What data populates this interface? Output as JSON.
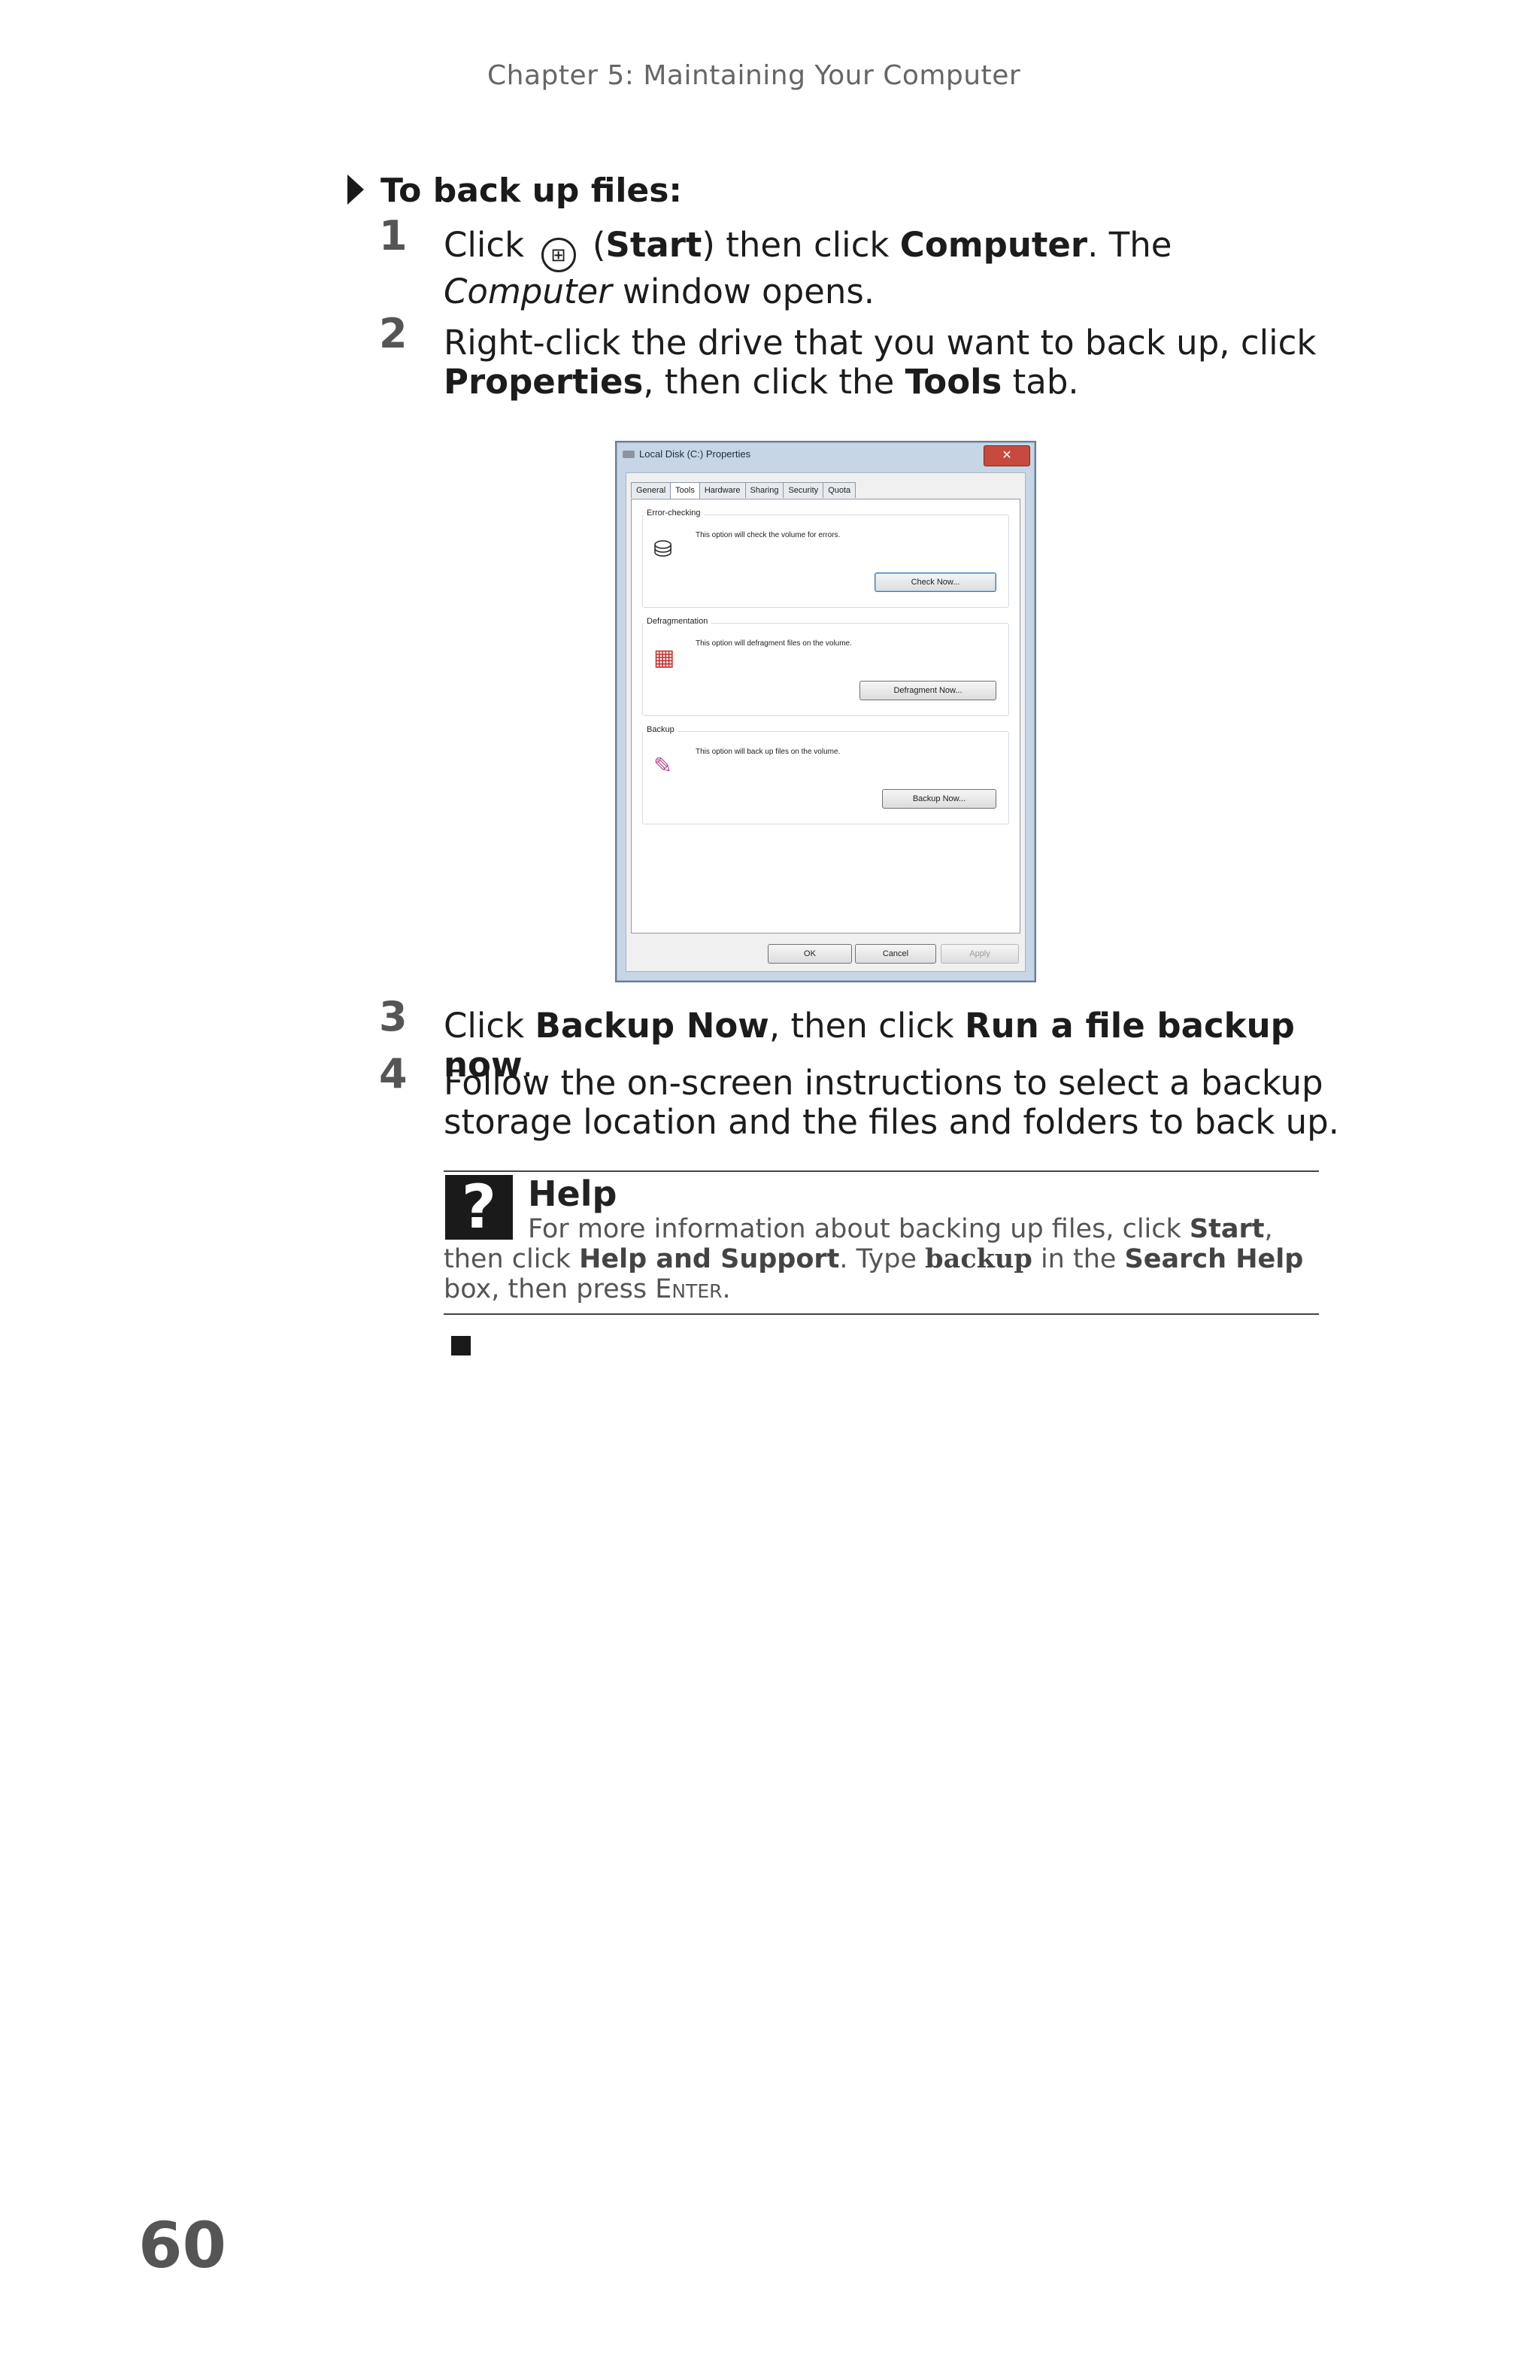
{
  "header": {
    "chapter": "Chapter 5: Maintaining Your Computer"
  },
  "section": {
    "heading": "To back up files:"
  },
  "steps": [
    {
      "num": "1",
      "parts": [
        "Click ",
        "(",
        "Start",
        ") then click ",
        "Computer",
        ". The ",
        "Computer",
        " window opens."
      ]
    },
    {
      "num": "2",
      "parts": [
        "Right-click the drive that you want to back up, click ",
        "Properties",
        ", then click the ",
        "Tools",
        " tab."
      ]
    },
    {
      "num": "3",
      "parts": [
        "Click ",
        "Backup Now",
        ", then click ",
        "Run a file backup now",
        "."
      ]
    },
    {
      "num": "4",
      "parts": [
        "Follow the on-screen instructions to select a backup storage location and the files and folders to back up."
      ]
    }
  ],
  "dialog": {
    "title": "Local Disk (C:) Properties",
    "close": "✕",
    "tabs": [
      "General",
      "Tools",
      "Hardware",
      "Sharing",
      "Security",
      "Quota"
    ],
    "groups": [
      {
        "label": "Error-checking",
        "text": "This option will check the volume for errors.",
        "button": "Check Now...",
        "icon": "check-disk-icon"
      },
      {
        "label": "Defragmentation",
        "text": "This option will defragment files on the volume.",
        "button": "Defragment Now...",
        "icon": "defragment-icon"
      },
      {
        "label": "Backup",
        "text": "This option will back up files on the volume.",
        "button": "Backup Now...",
        "icon": "backup-icon"
      }
    ],
    "buttons": {
      "ok": "OK",
      "cancel": "Cancel",
      "apply": "Apply"
    }
  },
  "help": {
    "q": "?",
    "title": "Help",
    "parts": [
      "For more information about backing up files, click ",
      "Start",
      ", then click ",
      "Help and Support",
      ". Type ",
      "backup",
      " in the ",
      "Search Help",
      " box, then press ",
      "Enter",
      "."
    ]
  },
  "page_number": "60"
}
